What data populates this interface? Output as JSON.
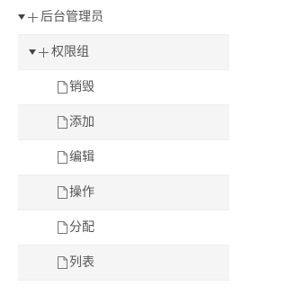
{
  "tree": {
    "root": {
      "label": "后台管理员",
      "expanded": true,
      "group": {
        "label": "权限组",
        "expanded": true,
        "items": [
          {
            "label": "销毁",
            "icon": "file-icon"
          },
          {
            "label": "添加",
            "icon": "file-icon"
          },
          {
            "label": "编辑",
            "icon": "file-icon"
          },
          {
            "label": "操作",
            "icon": "file-icon"
          },
          {
            "label": "分配",
            "icon": "file-icon"
          },
          {
            "label": "列表",
            "icon": "file-icon"
          }
        ]
      }
    }
  }
}
